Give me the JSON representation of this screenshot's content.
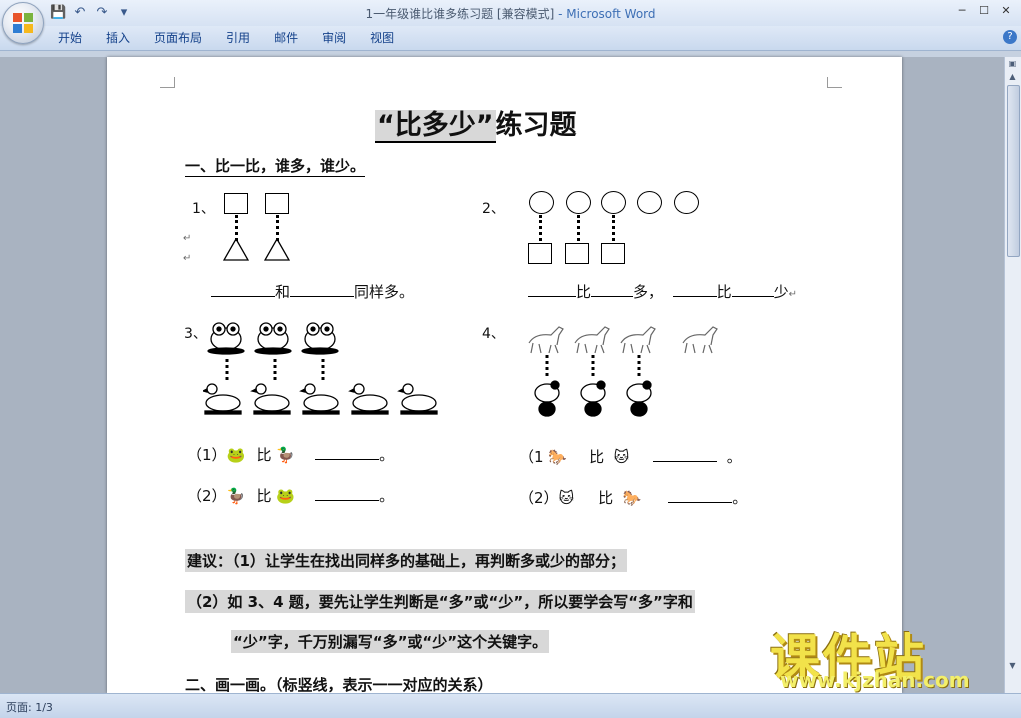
{
  "window": {
    "title": "1一年级谁比谁多练习题 [兼容模式]",
    "app_suffix": "- Microsoft Word"
  },
  "ribbon": {
    "tabs": [
      "开始",
      "插入",
      "页面布局",
      "引用",
      "邮件",
      "审阅",
      "视图"
    ]
  },
  "status": {
    "page": "页面: 1/3"
  },
  "doc": {
    "title_quoted": "“比多少”",
    "title_rest": "练习题",
    "section1": "一、比一比，谁多，谁少。",
    "q1_label": "1、",
    "q2_label": "2、",
    "q1_and": "和",
    "q1_same": "同样多。",
    "q2_bi1": "比",
    "q2_duo": "多，",
    "q2_bi2": "比",
    "q2_shao": "少",
    "q3_label": "3、",
    "q4_label": "4、",
    "q3_sub1": "（1）",
    "q3_sub2": "（2）",
    "bi": "比",
    "period": "。",
    "q4_sub1": "（1",
    "q4_sub2": "（2）",
    "advice1": "建议：（1）让学生在找出同样多的基础上，再判断多或少的部分；",
    "advice2": "（2）如 3、4 题，要先让学生判断是“多”或“少”，所以要学会写“多”字和",
    "advice3": "“少”字，千万别漏写“多”或“少”这个关键字。",
    "section2": "二、画一画。（标竖线，表示一一对应的关系）"
  },
  "watermark": {
    "text": "课件站",
    "url": "www.kjzhan.com"
  }
}
